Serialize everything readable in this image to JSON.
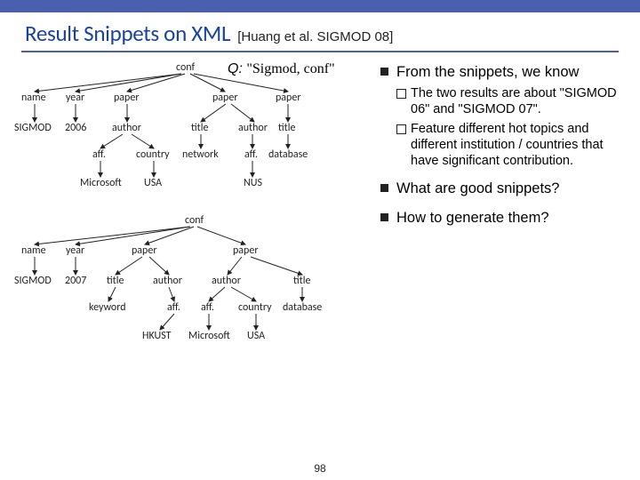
{
  "header": {
    "title": "Result Snippets on XML",
    "citation": "[Huang et al. SIGMOD 08]"
  },
  "query": {
    "label": "Q:",
    "value": "\"Sigmod, conf\""
  },
  "tree1": {
    "root": "conf",
    "name": "name",
    "year": "year",
    "paper1": "paper",
    "paper2": "paper",
    "paper3": "paper",
    "sigmod": "SIGMOD",
    "y2006": "2006",
    "author1": "author",
    "title1": "title",
    "author2": "author",
    "title2": "title",
    "aff1": "aff.",
    "country1": "country",
    "network": "network",
    "aff2": "aff.",
    "database": "database",
    "microsoft": "Microsoft",
    "usa": "USA",
    "nus": "NUS"
  },
  "tree2": {
    "root": "conf",
    "name": "name",
    "year": "year",
    "paper1": "paper",
    "paper2": "paper",
    "sigmod": "SIGMOD",
    "y2007": "2007",
    "title1": "title",
    "author1": "author",
    "author2": "author",
    "title2": "title",
    "keyword": "keyword",
    "aff1": "aff.",
    "aff2": "aff.",
    "country": "country",
    "database": "database",
    "hkust": "HKUST",
    "microsoft": "Microsoft",
    "usa": "USA"
  },
  "bullets": {
    "b1": "From the snippets, we know",
    "s1": "The two results are about \"SIGMOD 06\" and \"SIGMOD 07\".",
    "s2": "Feature different hot topics and different institution / countries that have significant contribution.",
    "b2": "What are good snippets?",
    "b3": "How to generate them?"
  },
  "page": "98"
}
